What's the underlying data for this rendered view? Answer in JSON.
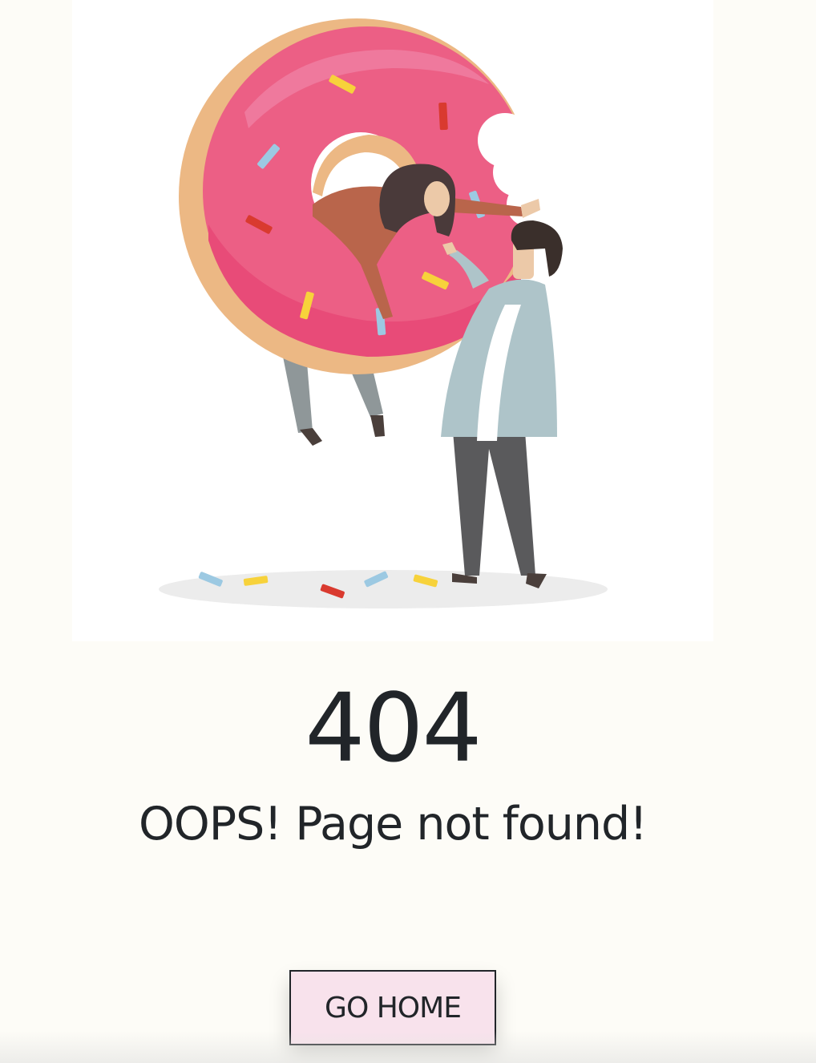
{
  "error": {
    "code": "404",
    "message": "OOPS! Page not found!"
  },
  "actions": {
    "go_home_label": "GO HOME"
  },
  "illustration": {
    "subject": "donut-with-people-illustration"
  },
  "colors": {
    "background": "#fdfcf7",
    "text": "#212529",
    "button_bg": "#f8e2ec",
    "donut_icing": "#ec5f85",
    "donut_dough": "#ecb884"
  }
}
